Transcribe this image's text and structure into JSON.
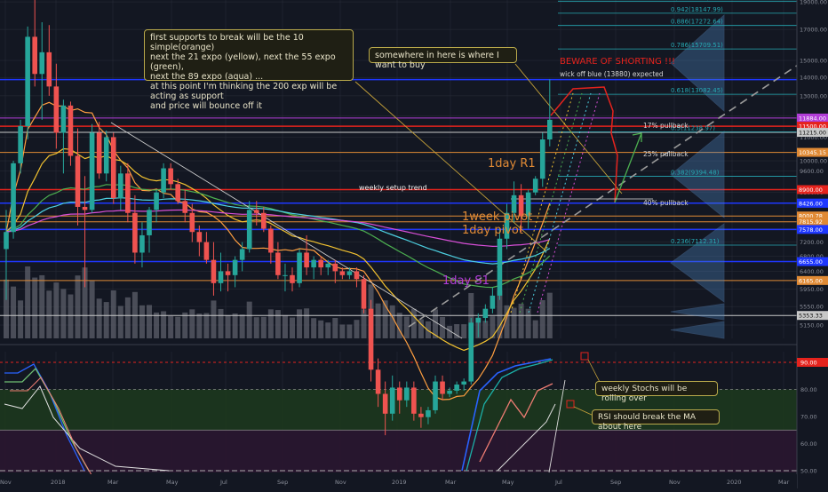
{
  "colors": {
    "bg": "#131722",
    "grid": "#2a2e39",
    "up": "#26a69a",
    "down": "#ef5350",
    "volume": "#5d606b",
    "ma21": "#f2c230",
    "ma10": "#ff9f40",
    "ma55": "#4caf50",
    "ma89": "#4dd0e1",
    "ma200": "#d84fd8",
    "blue": "#1e37ff",
    "red": "#e5231d",
    "white": "#c8c8c8",
    "stochK": "#2962ff",
    "stochD": "#ef7d73",
    "rsi": "#e2e2e2",
    "fib": "#26a9b3",
    "orange": "#e08a35",
    "violet": "#b23ed8"
  },
  "annotations": {
    "main_note": "first supports to break will be the 10 simple(orange)\nnext the 21 expo (yellow), next the 55 expo (green),\nnext the 89 expo (aqua) ...\nat this point I'm thinking the 200 exp will be acting as support\nand price will bounce off it",
    "buy_note": "somewhere in here is where I want to buy",
    "beware": "BEWARE OF SHORTING !!!",
    "wick_off": "wick off blue (13880) expected",
    "weekly_setup": "weekly setup trend",
    "day_r1": "1day R1",
    "week_pivot": "1week pivot",
    "day_pivot": "1day pivot",
    "day_s1": "1day S1",
    "pullback_17": "17% pullback",
    "pullback_25": "25% pullback",
    "pullback_40": "40% pullback",
    "stoch_note": "weekly Stochs will be rolling over",
    "rsi_note": "RSI should break the MA about here"
  },
  "chart_data": [
    {
      "type": "candlestick",
      "title": "",
      "timeframe": "weekly",
      "x_tick_labels": [
        "Nov",
        "2018",
        "Mar",
        "May",
        "Jul",
        "Sep",
        "Nov",
        "2019",
        "Mar",
        "May",
        "Jul",
        "Sep",
        "Nov",
        "2020",
        "Mar"
      ],
      "y_scale": "log",
      "y_tick_labels": [
        "19000.00",
        "17000.00",
        "15000.00",
        "14000.00",
        "13000.00",
        "12000.00",
        "11000.00",
        "10000.00",
        "9600.00",
        "8800.00",
        "8000.00",
        "7600.00",
        "7200.00",
        "6800.00",
        "6400.00",
        "5950.00",
        "5550.00",
        "5150.00"
      ],
      "ylim": [
        4900,
        19700
      ],
      "candles": [
        [
          7000,
          8200,
          5700,
          7500
        ],
        [
          7500,
          10000,
          7300,
          9900
        ],
        [
          9900,
          11800,
          9500,
          11500
        ],
        [
          11500,
          17200,
          10900,
          16500
        ],
        [
          16500,
          19700,
          13500,
          14200
        ],
        [
          14200,
          17500,
          11800,
          15500
        ],
        [
          15500,
          17300,
          13000,
          13500
        ],
        [
          13500,
          14800,
          10500,
          11200
        ],
        [
          11200,
          12800,
          9500,
          12500
        ],
        [
          12500,
          12700,
          9800,
          10200
        ],
        [
          10200,
          11400,
          7700,
          8300
        ],
        [
          8300,
          9400,
          6000,
          8200
        ],
        [
          8200,
          11600,
          8100,
          11200
        ],
        [
          11200,
          11700,
          9300,
          9500
        ],
        [
          9500,
          11300,
          9200,
          11000
        ],
        [
          11000,
          11200,
          8400,
          8600
        ],
        [
          8600,
          9800,
          8200,
          9500
        ],
        [
          9500,
          9900,
          7800,
          8100
        ],
        [
          8100,
          8700,
          6600,
          6900
        ],
        [
          6900,
          7800,
          6500,
          7400
        ],
        [
          7400,
          8300,
          6900,
          8200
        ],
        [
          8200,
          8900,
          7800,
          8800
        ],
        [
          8800,
          9900,
          8600,
          9700
        ],
        [
          9700,
          9900,
          8900,
          9100
        ],
        [
          9100,
          9300,
          8400,
          8500
        ],
        [
          8500,
          8900,
          7800,
          8100
        ],
        [
          8100,
          8400,
          7200,
          7500
        ],
        [
          7500,
          7700,
          6800,
          7200
        ],
        [
          7200,
          7500,
          6600,
          6700
        ],
        [
          6700,
          7200,
          5800,
          6100
        ],
        [
          6100,
          6900,
          5900,
          6400
        ],
        [
          6400,
          6600,
          5900,
          6300
        ],
        [
          6300,
          6800,
          6000,
          6700
        ],
        [
          6700,
          7200,
          6400,
          7000
        ],
        [
          7000,
          8500,
          6900,
          8200
        ],
        [
          8200,
          8500,
          7700,
          8100
        ],
        [
          8100,
          8300,
          7500,
          7600
        ],
        [
          7600,
          7700,
          6600,
          6900
        ],
        [
          6900,
          7200,
          6200,
          6300
        ],
        [
          6300,
          6600,
          5900,
          6300
        ],
        [
          6300,
          6500,
          5900,
          6100
        ],
        [
          6100,
          7000,
          6000,
          6900
        ],
        [
          6900,
          7400,
          6300,
          6500
        ],
        [
          6500,
          6800,
          6200,
          6700
        ],
        [
          6700,
          6800,
          6300,
          6500
        ],
        [
          6500,
          6700,
          6300,
          6600
        ],
        [
          6600,
          6700,
          6100,
          6400
        ],
        [
          6400,
          6500,
          6200,
          6300
        ],
        [
          6300,
          6500,
          6200,
          6400
        ],
        [
          6400,
          6500,
          6000,
          6200
        ],
        [
          6200,
          6300,
          5400,
          5500
        ],
        [
          5500,
          5700,
          4100,
          4300
        ],
        [
          4300,
          4500,
          3700,
          3900
        ],
        [
          3900,
          4100,
          3300,
          3600
        ],
        [
          3600,
          4200,
          3500,
          4000
        ],
        [
          4000,
          4100,
          3600,
          3800
        ],
        [
          3800,
          4100,
          3700,
          4000
        ],
        [
          4000,
          4100,
          3500,
          3600
        ],
        [
          3600,
          3700,
          3400,
          3550
        ],
        [
          3550,
          3700,
          3450,
          3650
        ],
        [
          3650,
          4200,
          3600,
          4100
        ],
        [
          4100,
          4200,
          3800,
          3900
        ],
        [
          3900,
          4000,
          3850,
          3950
        ],
        [
          3950,
          4100,
          3900,
          4050
        ],
        [
          4050,
          4150,
          3950,
          4100
        ],
        [
          4100,
          5300,
          4050,
          5200
        ],
        [
          5200,
          5400,
          4900,
          5300
        ],
        [
          5300,
          5600,
          5200,
          5500
        ],
        [
          5500,
          6000,
          5400,
          5800
        ],
        [
          5800,
          7600,
          5700,
          7300
        ],
        [
          7300,
          8400,
          7000,
          8100
        ],
        [
          8100,
          9200,
          7800,
          8700
        ],
        [
          8700,
          9100,
          7500,
          8000
        ],
        [
          8000,
          8900,
          7600,
          8800
        ],
        [
          8800,
          9400,
          8700,
          9300
        ],
        [
          9300,
          11200,
          9000,
          10900
        ],
        [
          10900,
          13900,
          10600,
          11800
        ]
      ],
      "overlays": [
        {
          "name": "10 simple (orange)"
        },
        {
          "name": "21 expo (yellow)"
        },
        {
          "name": "55 expo (green)"
        },
        {
          "name": "89 expo (aqua)"
        },
        {
          "name": "200 exp"
        }
      ],
      "horizontal_levels": [
        {
          "value": 13880,
          "color": "blue",
          "label": ""
        },
        {
          "value": 11884,
          "color": "violet",
          "label": "11884.00"
        },
        {
          "value": 11500,
          "color": "red",
          "label": "11500.00"
        },
        {
          "value": 11215,
          "color": "white",
          "label": "11215.00"
        },
        {
          "value": 10345,
          "color": "orange",
          "label": "10345.15"
        },
        {
          "value": 8900,
          "color": "red",
          "label": "8900.00"
        },
        {
          "value": 8425,
          "color": "blue",
          "label": "8425.00"
        },
        {
          "value": 8426,
          "color": "blue",
          "label": "8426.00"
        },
        {
          "value": 8000,
          "color": "orange",
          "label": "8000.78"
        },
        {
          "value": 7815.92,
          "color": "orange",
          "label": "7815.92"
        },
        {
          "value": 7578,
          "color": "blue",
          "label": "7578.00"
        },
        {
          "value": 6655,
          "color": "blue",
          "label": "6655.00"
        },
        {
          "value": 6165,
          "color": "orange",
          "label": "6165.00"
        },
        {
          "value": 5353.33,
          "color": "white",
          "label": "5353.33"
        }
      ],
      "fib_levels": [
        {
          "ratio": 1,
          "price": 19054.85,
          "label": "1(19054.85)"
        },
        {
          "ratio": 0.942,
          "price": 18147.99,
          "label": "0.942(18147.99)"
        },
        {
          "ratio": 0.886,
          "price": 17272.64,
          "label": "0.886(17272.64)"
        },
        {
          "ratio": 0.786,
          "price": 15709.51,
          "label": "0.786(15709.51)"
        },
        {
          "ratio": 0.618,
          "price": 13082.45,
          "label": "0.618(13082.45)"
        },
        {
          "ratio": 0.5,
          "price": 11238.97,
          "label": "0.5(11238.97)"
        },
        {
          "ratio": 0.382,
          "price": 9394.48,
          "label": "0.382(9394.48)"
        },
        {
          "ratio": 0.236,
          "price": 7112.31,
          "label": "0.236(7112.31)"
        }
      ]
    },
    {
      "type": "line",
      "title": "",
      "series": [
        {
          "name": "",
          "note": "stochastic %K/%D"
        }
      ],
      "y_tick_labels": [
        "90.00",
        "80.00",
        "70.00",
        "60.00",
        "50.00"
      ],
      "ylim": [
        50,
        95
      ],
      "overbought": 90
    }
  ]
}
